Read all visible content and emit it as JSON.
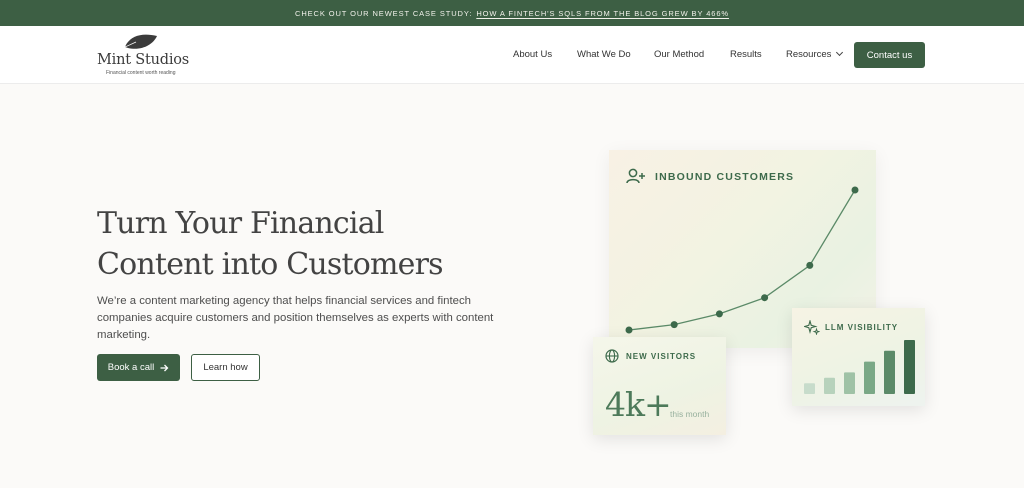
{
  "banner": {
    "prefix": "CHECK OUT OUR NEWEST CASE STUDY:",
    "link": "HOW A FINTECH'S SQLS FROM THE BLOG GREW BY 466%"
  },
  "logo": {
    "name": "Mint Studios",
    "tagline": "Financial content worth reading"
  },
  "nav": {
    "items": [
      "About Us",
      "What We Do",
      "Our Method",
      "Results",
      "Resources"
    ],
    "contact": "Contact us"
  },
  "hero": {
    "title_line1": "Turn Your Financial",
    "title_line2": "Content into Customers",
    "description": "We’re a content marketing agency that helps financial services and fintech companies acquire customers and position themselves as experts with content marketing.",
    "primary_cta": "Book a call",
    "secondary_cta": "Learn how"
  },
  "cards": {
    "inbound": {
      "title": "INBOUND CUSTOMERS",
      "points": [
        1,
        2,
        4,
        7,
        13,
        27
      ]
    },
    "visitors": {
      "title": "NEW VISITORS",
      "value": "4k+",
      "sub": "this month"
    },
    "llm": {
      "title": "LLM VISIBILITY",
      "bars": [
        1,
        1.5,
        2,
        3,
        4,
        5
      ]
    }
  },
  "colors": {
    "brand": "#3d5f44",
    "accent": "#4d7a5a"
  },
  "icons": [
    "leaf-icon",
    "chevron-down-icon",
    "arrow-right-icon",
    "user-plus-icon",
    "globe-icon",
    "sparkle-icon"
  ]
}
